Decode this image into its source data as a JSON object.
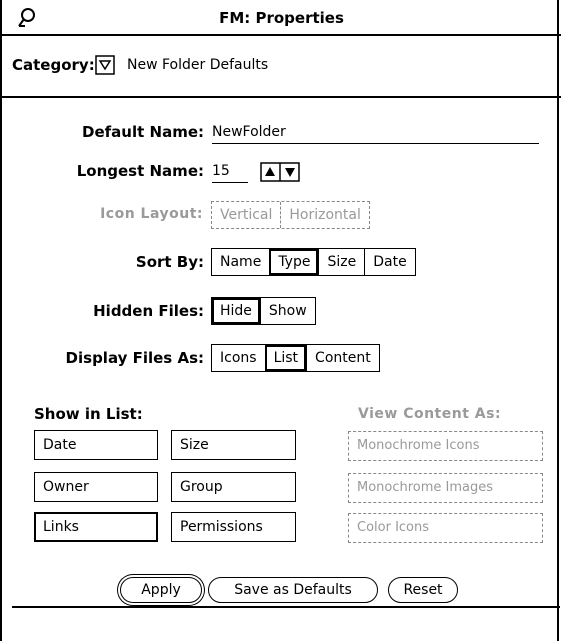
{
  "window": {
    "title": "FM: Properties",
    "menu_icon": "glyph-icon"
  },
  "category": {
    "label": "Category:",
    "value": "New Folder Defaults",
    "menu_icon": "triangle-down-icon"
  },
  "fields": {
    "default_name": {
      "label": "Default Name:",
      "value": "NewFolder"
    },
    "longest_name": {
      "label": "Longest Name:",
      "value": "15"
    }
  },
  "icon_layout": {
    "label": "Icon Layout:",
    "options": [
      "Vertical",
      "Horizontal"
    ]
  },
  "sort_by": {
    "label": "Sort By:",
    "options": [
      "Name",
      "Type",
      "Size",
      "Date"
    ],
    "selected": "Type"
  },
  "hidden_files": {
    "label": "Hidden Files:",
    "options": [
      "Hide",
      "Show"
    ],
    "selected": "Hide"
  },
  "display_as": {
    "label": "Display Files As:",
    "options": [
      "Icons",
      "List",
      "Content"
    ],
    "selected": "List"
  },
  "show_in_list": {
    "label": "Show in List:",
    "items": [
      "Date",
      "Size",
      "Owner",
      "Group",
      "Links",
      "Permissions"
    ],
    "selected": "Links"
  },
  "view_content_as": {
    "label": "View Content As:",
    "items": [
      "Monochrome Icons",
      "Monochrome Images",
      "Color Icons"
    ]
  },
  "buttons": {
    "apply": "Apply",
    "save_defaults": "Save as Defaults",
    "reset": "Reset"
  }
}
